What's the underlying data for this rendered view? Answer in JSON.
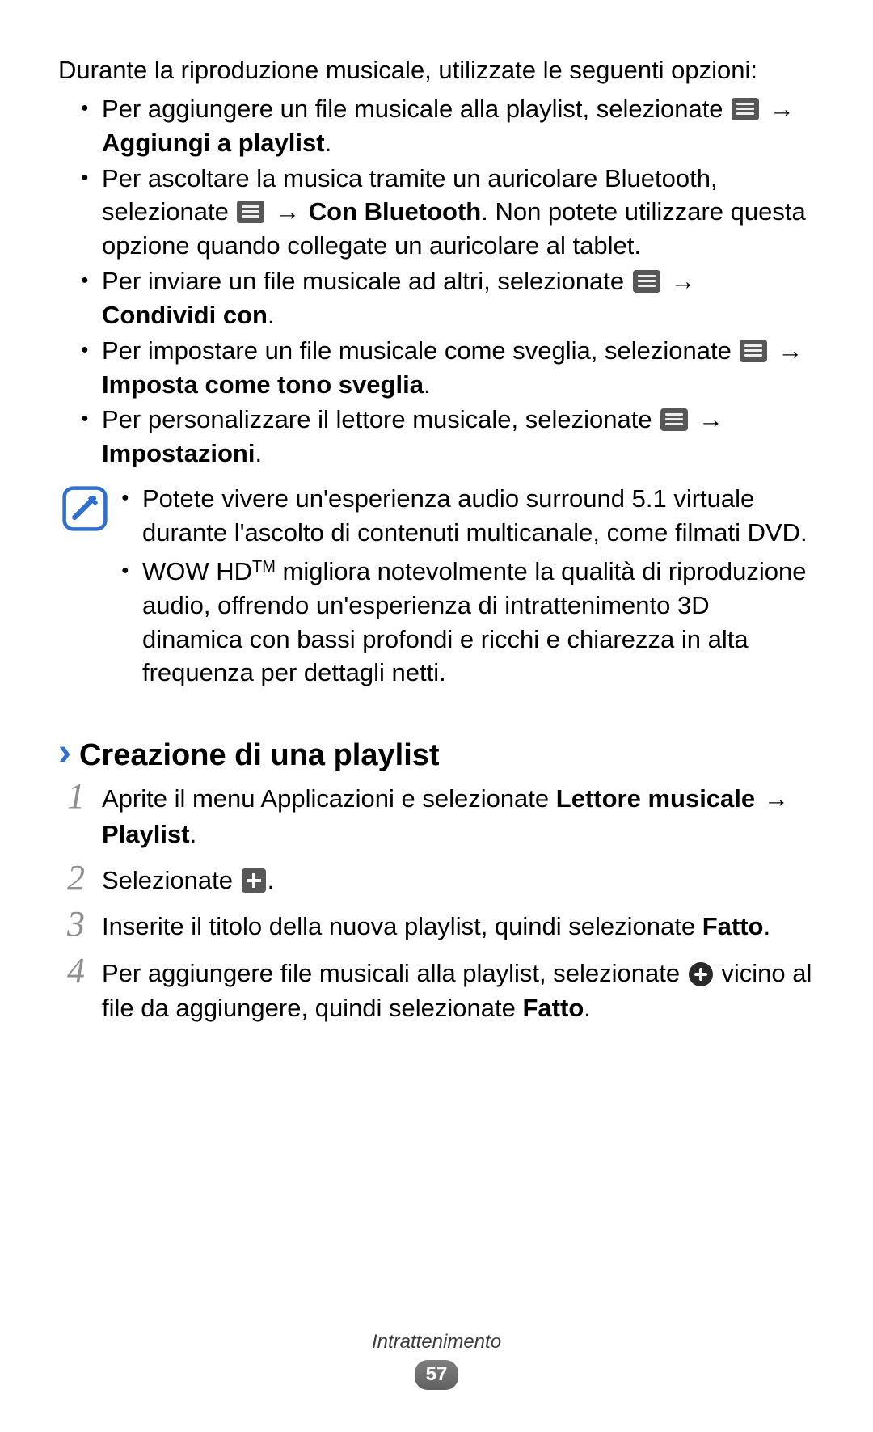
{
  "intro": "Durante la riproduzione musicale, utilizzate le seguenti opzioni:",
  "arrow": "→",
  "options": [
    {
      "pre": "Per aggiungere un file musicale alla playlist, selezionate ",
      "bold_after": "Aggiungi a playlist",
      "end": "."
    },
    {
      "pre": "Per ascoltare la musica tramite un auricolare Bluetooth, selezionate ",
      "bold_after": "Con Bluetooth",
      "post": ". Non potete utilizzare questa opzione quando collegate un auricolare al tablet."
    },
    {
      "pre": "Per inviare un file musicale ad altri, selezionate ",
      "bold_after": "Condividi con",
      "end": "."
    },
    {
      "pre": "Per impostare un file musicale come sveglia, selezionate ",
      "bold_after": "Imposta come tono sveglia",
      "end": "."
    },
    {
      "pre": "Per personalizzare il lettore musicale, selezionate ",
      "bold_after": "Impostazioni",
      "end": "."
    }
  ],
  "notes": {
    "n1": "Potete vivere un'esperienza audio surround 5.1 virtuale durante l'ascolto di contenuti multicanale, come filmati DVD.",
    "n2_pre": "WOW HD",
    "n2_tm": "TM",
    "n2_post": " migliora notevolmente la qualità di riproduzione audio, offrendo un'esperienza di intrattenimento 3D dinamica con bassi profondi e ricchi e chiarezza in alta frequenza per dettagli netti."
  },
  "section_title": "Creazione di una playlist",
  "steps": {
    "s1_pre": "Aprite il menu Applicazioni e selezionate ",
    "s1_b1": "Lettore musicale",
    "s1_mid": " ",
    "s1_b2": "Playlist",
    "s1_end": ".",
    "s2_pre": "Selezionate ",
    "s2_end": ".",
    "s3_pre": "Inserite il titolo della nuova playlist, quindi selezionate ",
    "s3_b": "Fatto",
    "s3_end": ".",
    "s4_pre": "Per aggiungere file musicali alla playlist, selezionate ",
    "s4_mid": " vicino al file da aggiungere, quindi selezionate ",
    "s4_b": "Fatto",
    "s4_end": "."
  },
  "footer": {
    "section": "Intrattenimento",
    "page": "57"
  },
  "icon_names": {
    "menu": "menu-icon",
    "plus": "plus-icon",
    "circle_plus": "add-circle-icon",
    "note": "note-icon",
    "chev": "›"
  }
}
